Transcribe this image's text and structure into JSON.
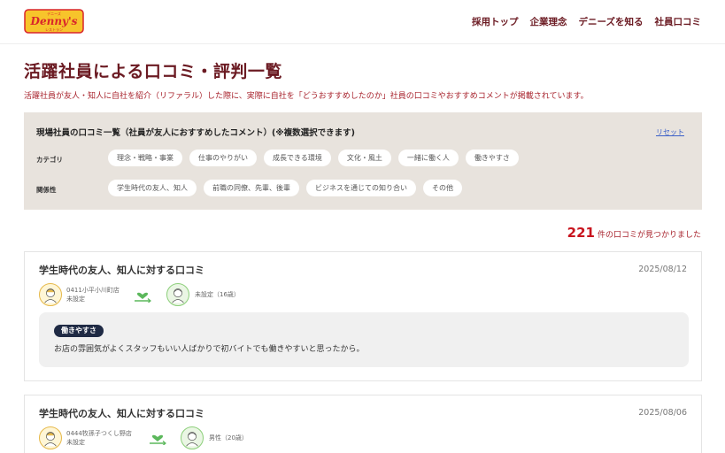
{
  "brand": {
    "logo_text": "Denny's",
    "logo_sub_top": "デニーズ",
    "logo_sub_bottom": "レストラン",
    "logo_color": "#d9252b",
    "logo_bg": "#f7c42b"
  },
  "nav": [
    {
      "label": "採用トップ"
    },
    {
      "label": "企業理念"
    },
    {
      "label": "デニーズを知る"
    },
    {
      "label": "社員口コミ"
    }
  ],
  "page": {
    "title": "活躍社員による口コミ・評判一覧",
    "description": "活躍社員が友人・知人に自社を紹介（リファラル）した際に、実際に自社を「どうおすすめしたのか」社員の口コミやおすすめコメントが掲載されています。"
  },
  "filter": {
    "title": "現場社員の口コミ一覧（社員が友人におすすめしたコメント）(※複数選択できます)",
    "reset_label": "リセット",
    "category_label": "カテゴリ",
    "categories": [
      {
        "label": "理念・戦略・事業"
      },
      {
        "label": "仕事のやりがい"
      },
      {
        "label": "成長できる環境"
      },
      {
        "label": "文化・風土"
      },
      {
        "label": "一緒に働く人"
      },
      {
        "label": "働きやすさ"
      }
    ],
    "relation_label": "関係性",
    "relations": [
      {
        "label": "学生時代の友人、知人"
      },
      {
        "label": "前職の同僚、先輩、後輩"
      },
      {
        "label": "ビジネスを通じての知り合い"
      },
      {
        "label": "その他"
      }
    ]
  },
  "results": {
    "count": "221",
    "suffix": "件の口コミが見つかりました"
  },
  "reviews": [
    {
      "title": "学生時代の友人、知人に対する口コミ",
      "date": "2025/08/12",
      "staff_store": "0411小平小川町店",
      "staff_status": "未設定",
      "friend_info": "未設定（16歳）",
      "tag": "働きやすさ",
      "comment": "お店の雰囲気がよくスタッフもいい人ばかりで初バイトでも働きやすいと思ったから。"
    },
    {
      "title": "学生時代の友人、知人に対する口コミ",
      "date": "2025/08/06",
      "staff_store": "0444牧孫子つくし野店",
      "staff_status": "未設定",
      "friend_info": "男性（20歳）",
      "tag": "",
      "comment": ""
    }
  ],
  "colors": {
    "accent_dark": "#6b1a22",
    "accent_red": "#c8141e",
    "filter_bg": "#e8e3dd",
    "tag_bg": "#1f2a44",
    "link_green": "#5cb85c"
  }
}
